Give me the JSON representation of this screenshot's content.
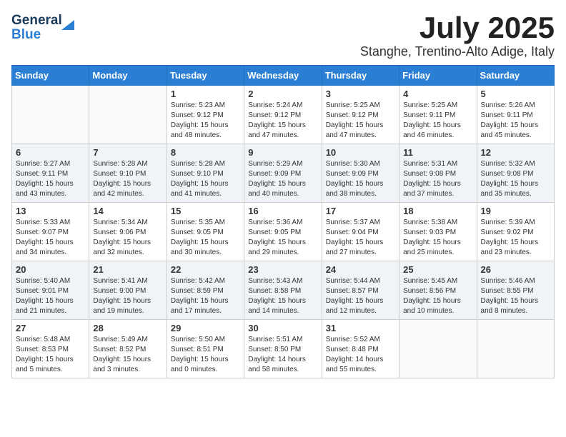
{
  "header": {
    "logo_general": "General",
    "logo_blue": "Blue",
    "month_title": "July 2025",
    "location": "Stanghe, Trentino-Alto Adige, Italy"
  },
  "weekdays": [
    "Sunday",
    "Monday",
    "Tuesday",
    "Wednesday",
    "Thursday",
    "Friday",
    "Saturday"
  ],
  "weeks": [
    [
      {
        "day": "",
        "info": ""
      },
      {
        "day": "",
        "info": ""
      },
      {
        "day": "1",
        "info": "Sunrise: 5:23 AM\nSunset: 9:12 PM\nDaylight: 15 hours\nand 48 minutes."
      },
      {
        "day": "2",
        "info": "Sunrise: 5:24 AM\nSunset: 9:12 PM\nDaylight: 15 hours\nand 47 minutes."
      },
      {
        "day": "3",
        "info": "Sunrise: 5:25 AM\nSunset: 9:12 PM\nDaylight: 15 hours\nand 47 minutes."
      },
      {
        "day": "4",
        "info": "Sunrise: 5:25 AM\nSunset: 9:11 PM\nDaylight: 15 hours\nand 46 minutes."
      },
      {
        "day": "5",
        "info": "Sunrise: 5:26 AM\nSunset: 9:11 PM\nDaylight: 15 hours\nand 45 minutes."
      }
    ],
    [
      {
        "day": "6",
        "info": "Sunrise: 5:27 AM\nSunset: 9:11 PM\nDaylight: 15 hours\nand 43 minutes."
      },
      {
        "day": "7",
        "info": "Sunrise: 5:28 AM\nSunset: 9:10 PM\nDaylight: 15 hours\nand 42 minutes."
      },
      {
        "day": "8",
        "info": "Sunrise: 5:28 AM\nSunset: 9:10 PM\nDaylight: 15 hours\nand 41 minutes."
      },
      {
        "day": "9",
        "info": "Sunrise: 5:29 AM\nSunset: 9:09 PM\nDaylight: 15 hours\nand 40 minutes."
      },
      {
        "day": "10",
        "info": "Sunrise: 5:30 AM\nSunset: 9:09 PM\nDaylight: 15 hours\nand 38 minutes."
      },
      {
        "day": "11",
        "info": "Sunrise: 5:31 AM\nSunset: 9:08 PM\nDaylight: 15 hours\nand 37 minutes."
      },
      {
        "day": "12",
        "info": "Sunrise: 5:32 AM\nSunset: 9:08 PM\nDaylight: 15 hours\nand 35 minutes."
      }
    ],
    [
      {
        "day": "13",
        "info": "Sunrise: 5:33 AM\nSunset: 9:07 PM\nDaylight: 15 hours\nand 34 minutes."
      },
      {
        "day": "14",
        "info": "Sunrise: 5:34 AM\nSunset: 9:06 PM\nDaylight: 15 hours\nand 32 minutes."
      },
      {
        "day": "15",
        "info": "Sunrise: 5:35 AM\nSunset: 9:05 PM\nDaylight: 15 hours\nand 30 minutes."
      },
      {
        "day": "16",
        "info": "Sunrise: 5:36 AM\nSunset: 9:05 PM\nDaylight: 15 hours\nand 29 minutes."
      },
      {
        "day": "17",
        "info": "Sunrise: 5:37 AM\nSunset: 9:04 PM\nDaylight: 15 hours\nand 27 minutes."
      },
      {
        "day": "18",
        "info": "Sunrise: 5:38 AM\nSunset: 9:03 PM\nDaylight: 15 hours\nand 25 minutes."
      },
      {
        "day": "19",
        "info": "Sunrise: 5:39 AM\nSunset: 9:02 PM\nDaylight: 15 hours\nand 23 minutes."
      }
    ],
    [
      {
        "day": "20",
        "info": "Sunrise: 5:40 AM\nSunset: 9:01 PM\nDaylight: 15 hours\nand 21 minutes."
      },
      {
        "day": "21",
        "info": "Sunrise: 5:41 AM\nSunset: 9:00 PM\nDaylight: 15 hours\nand 19 minutes."
      },
      {
        "day": "22",
        "info": "Sunrise: 5:42 AM\nSunset: 8:59 PM\nDaylight: 15 hours\nand 17 minutes."
      },
      {
        "day": "23",
        "info": "Sunrise: 5:43 AM\nSunset: 8:58 PM\nDaylight: 15 hours\nand 14 minutes."
      },
      {
        "day": "24",
        "info": "Sunrise: 5:44 AM\nSunset: 8:57 PM\nDaylight: 15 hours\nand 12 minutes."
      },
      {
        "day": "25",
        "info": "Sunrise: 5:45 AM\nSunset: 8:56 PM\nDaylight: 15 hours\nand 10 minutes."
      },
      {
        "day": "26",
        "info": "Sunrise: 5:46 AM\nSunset: 8:55 PM\nDaylight: 15 hours\nand 8 minutes."
      }
    ],
    [
      {
        "day": "27",
        "info": "Sunrise: 5:48 AM\nSunset: 8:53 PM\nDaylight: 15 hours\nand 5 minutes."
      },
      {
        "day": "28",
        "info": "Sunrise: 5:49 AM\nSunset: 8:52 PM\nDaylight: 15 hours\nand 3 minutes."
      },
      {
        "day": "29",
        "info": "Sunrise: 5:50 AM\nSunset: 8:51 PM\nDaylight: 15 hours\nand 0 minutes."
      },
      {
        "day": "30",
        "info": "Sunrise: 5:51 AM\nSunset: 8:50 PM\nDaylight: 14 hours\nand 58 minutes."
      },
      {
        "day": "31",
        "info": "Sunrise: 5:52 AM\nSunset: 8:48 PM\nDaylight: 14 hours\nand 55 minutes."
      },
      {
        "day": "",
        "info": ""
      },
      {
        "day": "",
        "info": ""
      }
    ]
  ]
}
